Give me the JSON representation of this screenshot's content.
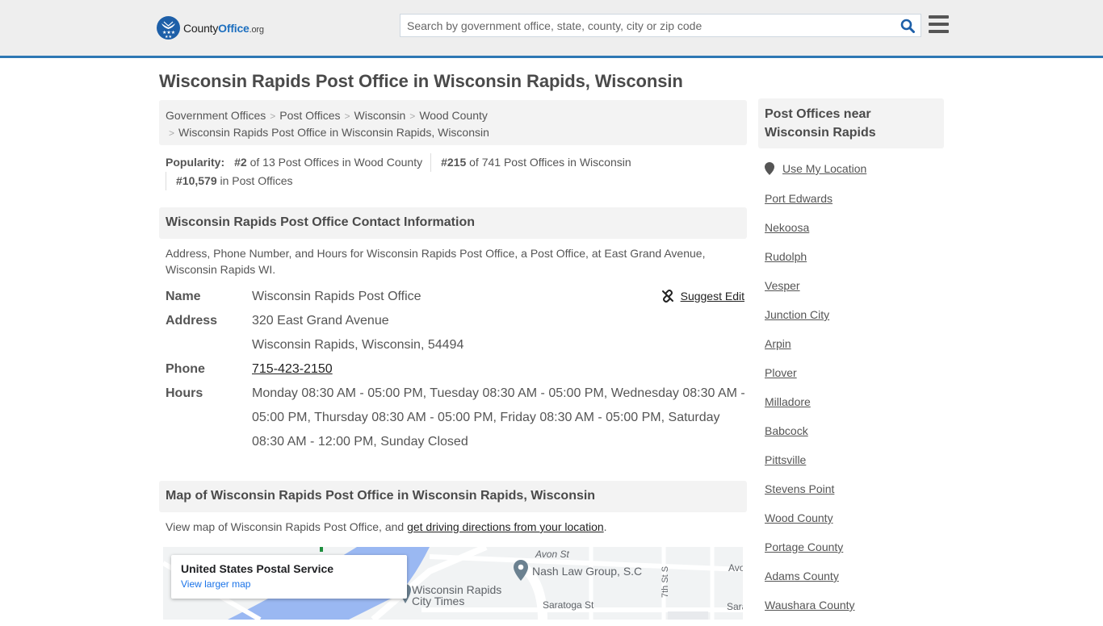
{
  "header": {
    "logo": {
      "brand_part1": "County",
      "brand_part2": "Office",
      "brand_tld": ".org"
    },
    "search": {
      "placeholder": "Search by government office, state, county, city or zip code",
      "value": ""
    },
    "icons": {
      "search": "search-icon",
      "menu": "hamburger-menu-icon"
    }
  },
  "page": {
    "title": "Wisconsin Rapids Post Office in Wisconsin Rapids, Wisconsin"
  },
  "breadcrumb": {
    "items": [
      "Government Offices",
      "Post Offices",
      "Wisconsin",
      "Wood County"
    ],
    "current": "Wisconsin Rapids Post Office in Wisconsin Rapids, Wisconsin",
    "separator": ">"
  },
  "popularity": {
    "label": "Popularity:",
    "items": [
      {
        "rank": "#2",
        "text": " of 13 Post Offices in Wood County"
      },
      {
        "rank": "#215",
        "text": " of 741 Post Offices in Wisconsin"
      },
      {
        "rank": "#10,579",
        "text": " in Post Offices"
      }
    ]
  },
  "contact": {
    "heading": "Wisconsin Rapids Post Office Contact Information",
    "description": "Address, Phone Number, and Hours for Wisconsin Rapids Post Office, a Post Office, at East Grand Avenue, Wisconsin Rapids WI.",
    "suggest_edit": "Suggest Edit",
    "fields": {
      "name_label": "Name",
      "name": "Wisconsin Rapids Post Office",
      "address_label": "Address",
      "address_line1": "320 East Grand Avenue",
      "address_line2": "Wisconsin Rapids, Wisconsin, 54494",
      "phone_label": "Phone",
      "phone": "715-423-2150",
      "hours_label": "Hours",
      "hours": "Monday 08:30 AM - 05:00 PM, Tuesday 08:30 AM - 05:00 PM, Wednesday 08:30 AM - 05:00 PM, Thursday 08:30 AM - 05:00 PM, Friday 08:30 AM - 05:00 PM, Saturday 08:30 AM - 12:00 PM, Sunday Closed"
    }
  },
  "map_section": {
    "heading": "Map of Wisconsin Rapids Post Office in Wisconsin Rapids, Wisconsin",
    "desc_prefix": "View map of Wisconsin Rapids Post Office, and ",
    "desc_link": "get driving directions from your location",
    "desc_suffix": ".",
    "card_title": "United States Postal Service",
    "card_link": "View larger map",
    "labels": {
      "poi1_line1": "Wisconsin Rapids",
      "poi1_line2": "City Times",
      "poi2": "Nash Law Group, S.C",
      "street1": "Avon St",
      "street2": "Saratoga St",
      "street3": "7th St S",
      "street4": "Avo",
      "street5": "Sara"
    },
    "colors": {
      "water": "#9ab8f2",
      "land": "#f1f3f4",
      "road": "#ffffff",
      "pin": "#6b8190"
    }
  },
  "sidebar": {
    "heading": "Post Offices near Wisconsin Rapids",
    "use_location": "Use My Location",
    "links": [
      "Port Edwards",
      "Nekoosa",
      "Rudolph",
      "Vesper",
      "Junction City",
      "Arpin",
      "Plover",
      "Milladore",
      "Babcock",
      "Pittsville",
      "Stevens Point",
      "Wood County",
      "Portage County",
      "Adams County",
      "Waushara County"
    ]
  },
  "colors": {
    "accent": "#2e78b4",
    "brand_blue": "#1d5fa8",
    "header_bg": "#eeeeee",
    "panel_bg": "#f3f3f3",
    "text": "#555555"
  }
}
